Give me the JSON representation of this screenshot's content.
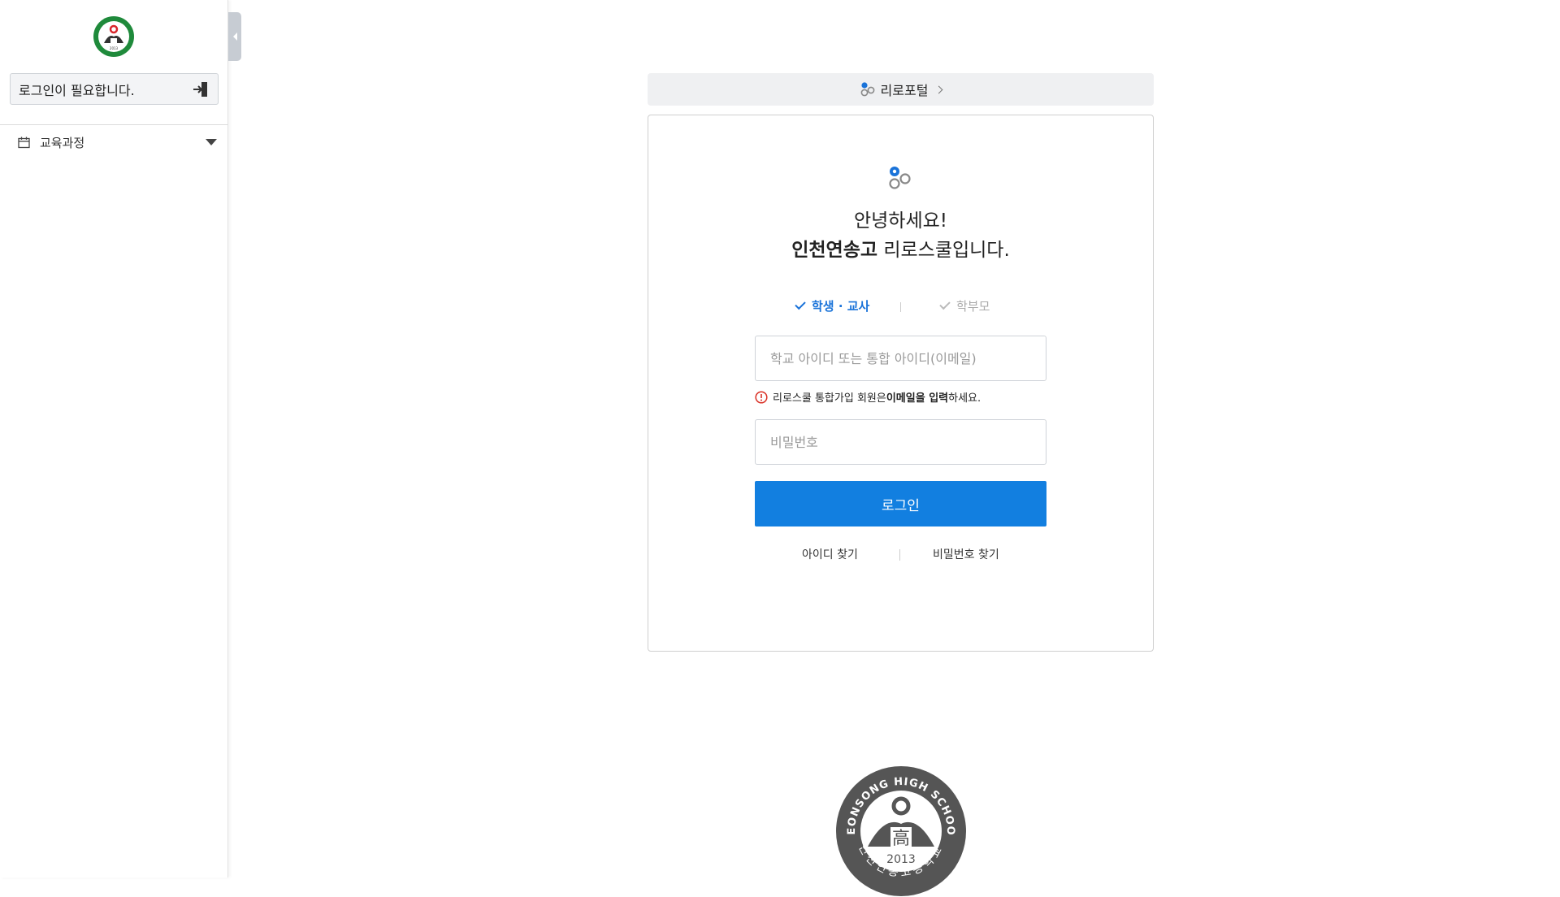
{
  "sidebar": {
    "login_prompt": "로그인이 필요합니다.",
    "menu": [
      {
        "label": "교육과정",
        "icon": "calendar-icon"
      }
    ],
    "logo_icon": "school-emblem-icon",
    "login_icon": "sign-in-icon"
  },
  "portal": {
    "label": "리로포털",
    "icon": "riro-logo-icon"
  },
  "login": {
    "greeting_line1": "안녕하세요!",
    "school_name": "인천연송고",
    "greeting_line2_suffix": " 리로스쿨입니다.",
    "tabs": [
      {
        "label": "학생 · 교사",
        "selected": true
      },
      {
        "label": "학부모",
        "selected": false
      }
    ],
    "id_placeholder": "학교 아이디 또는 통합 아이디(이메일)",
    "id_value": "",
    "hint_prefix": "리로스쿨 통합가입 회원은 ",
    "hint_bold": "이메일을 입력",
    "hint_suffix": "하세요.",
    "password_placeholder": "비밀번호",
    "password_value": "",
    "submit_label": "로그인",
    "find_id": "아이디 찾기",
    "find_password": "비밀번호 찾기"
  },
  "seal": {
    "top_text": "YEONSONG HIGH SCHOOL",
    "center_char": "高",
    "year": "2013",
    "bottom_text": "인천연송고등학교"
  },
  "colors": {
    "accent": "#127fe0",
    "tab_active": "#1a73d9",
    "warn": "#d93025",
    "emblem_green": "#1f8a3b",
    "seal_gray": "#555555"
  }
}
